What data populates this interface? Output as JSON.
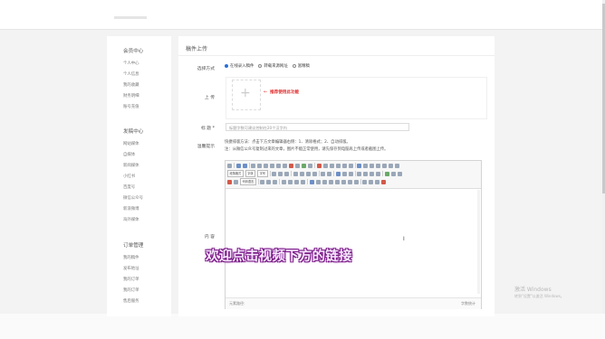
{
  "sidebar": {
    "sections": [
      {
        "title": "会员中心",
        "items": [
          "个人中心",
          "个人信息",
          "我的收藏",
          "财务明细",
          "账号充值"
        ]
      },
      {
        "title": "发稿中心",
        "items": [
          "网站媒体",
          "自媒体",
          "新闻媒体",
          "小红书",
          "百度号",
          "微信公众号",
          "新浪微博",
          "海外媒体"
        ]
      },
      {
        "title": "订单管理",
        "items": [
          "我的稿件",
          "发布地址",
          "我的订单",
          "我的订单",
          "售后服务"
        ]
      }
    ]
  },
  "main": {
    "page_title": "稿件上传",
    "labels": {
      "mode": "选择方式",
      "upload": "上 传",
      "title": "标 题 *",
      "tips": "温馨提示",
      "content": "内 容"
    },
    "mode_options": [
      {
        "label": "在线录入稿件",
        "selected": true
      },
      {
        "label": "转载来源网址",
        "selected": false
      },
      {
        "label": "富精稿",
        "selected": false
      }
    ],
    "upload_hint_arrow": "←",
    "upload_hint": "推荐使用此功能",
    "title_placeholder": "标题字数可建议控制在20个汉字内",
    "tips": [
      "快捷排版方法：点击下方文章编辑器右侧：1、清除格式；2、自动排版。",
      "注：从微信公众号复制过来的文章，图片不能正常使用，请先保存到电脑再上传或者截图上传。"
    ],
    "editor": {
      "selects": [
        "段落格式",
        "字体",
        "字号"
      ],
      "selects_row3": [
        "代码语言"
      ],
      "path_label": "元素路径:",
      "count_label": "字数统计"
    }
  },
  "overlay": {
    "caption": "欢迎点击视频下方的链接",
    "activate_line1": "激活 Windows",
    "activate_line2": "转到\"设置\"以激活 Windows。"
  },
  "colors": {
    "accent": "#2a6fdc",
    "hint_red": "#e02b2b",
    "caption_stroke": "#7a1a86"
  }
}
